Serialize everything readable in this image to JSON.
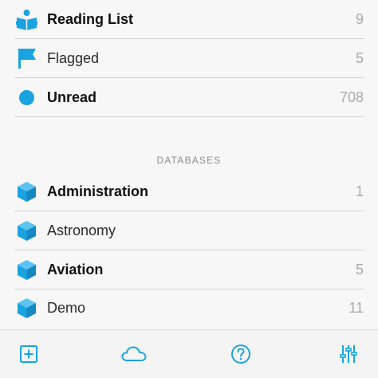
{
  "smart_lists": [
    {
      "label": "Reading List",
      "count": "9",
      "icon": "reading-person-icon",
      "bold": true
    },
    {
      "label": "Flagged",
      "count": "5",
      "icon": "flag-icon",
      "bold": false
    },
    {
      "label": "Unread",
      "count": "708",
      "icon": "unread-dot-icon",
      "bold": true
    }
  ],
  "databases_header": "DATABASES",
  "databases": [
    {
      "label": "Administration",
      "count": "1",
      "icon": "cube-icon",
      "bold": true
    },
    {
      "label": "Astronomy",
      "count": "",
      "icon": "cube-icon",
      "bold": false
    },
    {
      "label": "Aviation",
      "count": "5",
      "icon": "cube-icon",
      "bold": true
    },
    {
      "label": "Demo",
      "count": "11",
      "icon": "cube-icon",
      "bold": false
    }
  ],
  "toolbar": [
    {
      "icon": "add-square-icon"
    },
    {
      "icon": "cloud-icon"
    },
    {
      "icon": "help-icon"
    },
    {
      "icon": "sliders-icon"
    }
  ],
  "colors": {
    "accent": "#1aa3e0",
    "accent_dark": "#1688c4",
    "accent_light": "#5cc4f0",
    "text": "#111111",
    "count": "#a9a9a9",
    "divider": "#cfcfcf",
    "background": "#f7f7f7"
  }
}
